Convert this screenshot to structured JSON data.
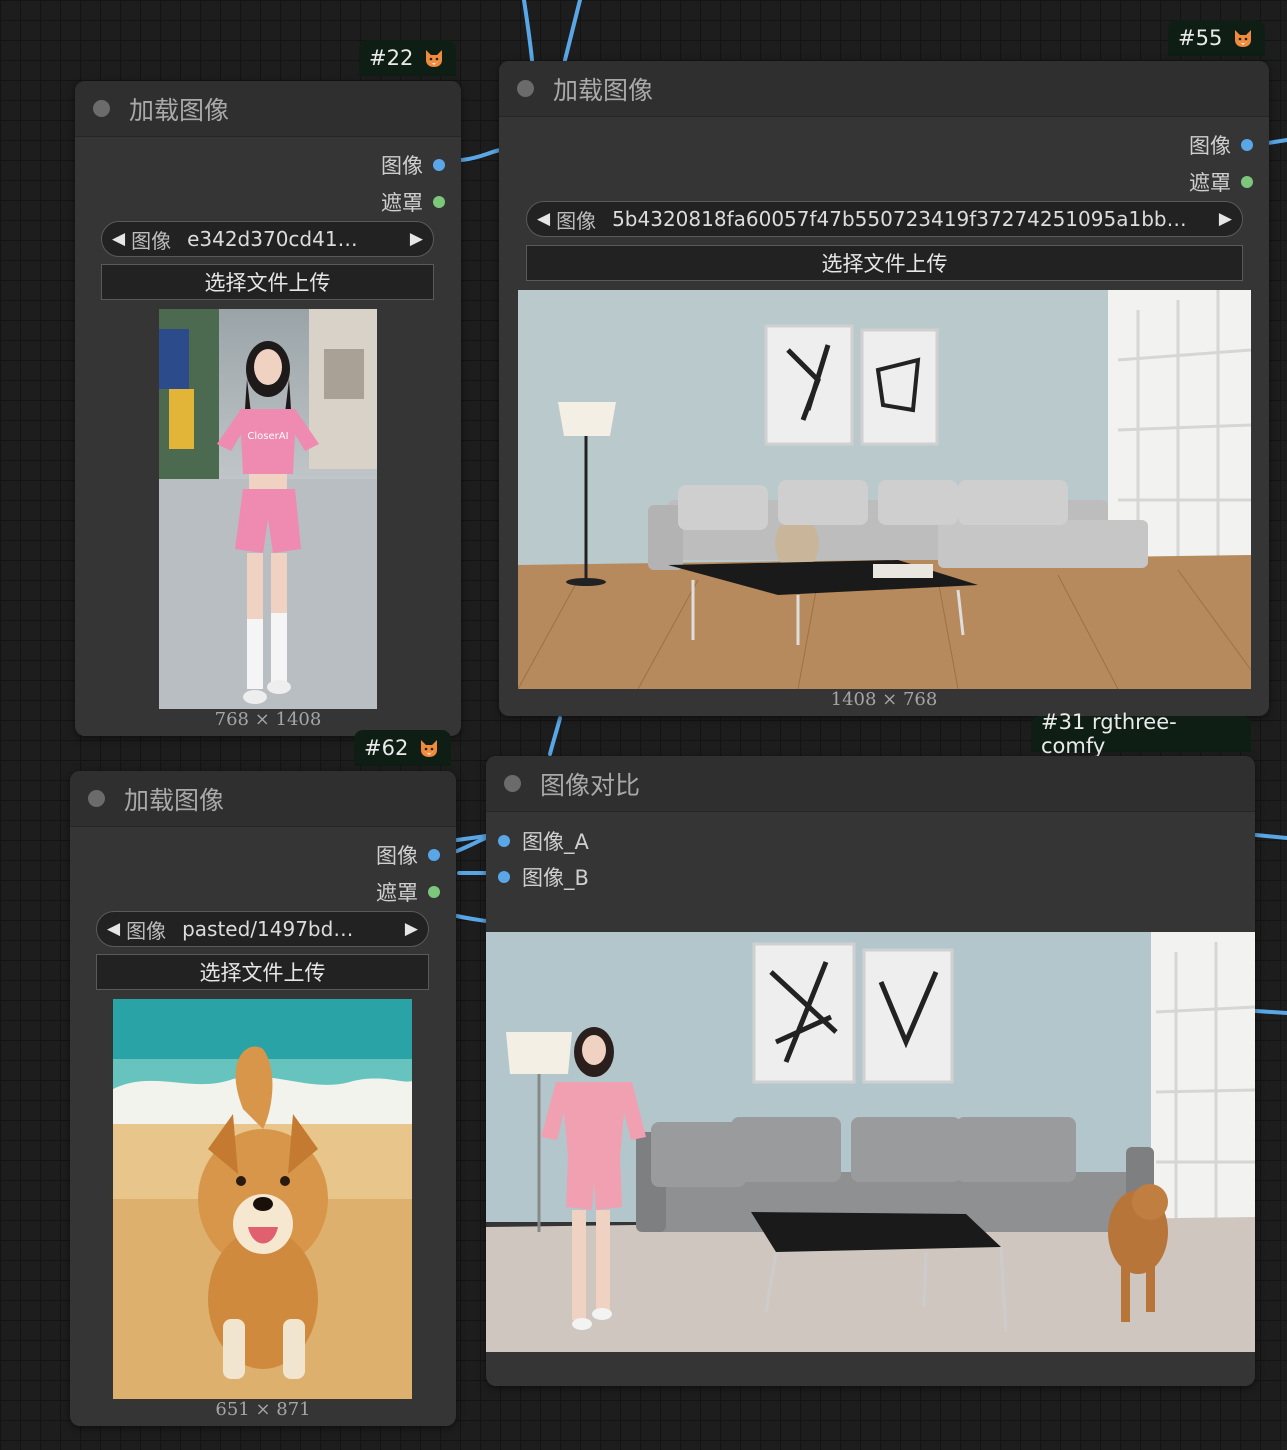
{
  "nodes": {
    "n22": {
      "badge": "#22",
      "title": "加载图像",
      "outputs": [
        "图像",
        "遮罩"
      ],
      "combo": {
        "label": "图像",
        "value": "e342d370cd41…"
      },
      "upload_label": "选择文件上传",
      "size": "768 × 1408"
    },
    "n55": {
      "badge": "#55",
      "title": "加载图像",
      "outputs": [
        "图像",
        "遮罩"
      ],
      "combo": {
        "label": "图像",
        "value": "5b4320818fa60057f47b550723419f37274251095a1bb…"
      },
      "upload_label": "选择文件上传",
      "size": "1408 × 768"
    },
    "n62": {
      "badge": "#62",
      "title": "加载图像",
      "outputs": [
        "图像",
        "遮罩"
      ],
      "combo": {
        "label": "图像",
        "value": "pasted/1497bd…"
      },
      "upload_label": "选择文件上传",
      "size": "651 × 871"
    },
    "n31": {
      "badge": "#31 rgthree-comfy",
      "title": "图像对比",
      "inputs": [
        "图像_A",
        "图像_B"
      ]
    }
  },
  "previews": {
    "n22": {
      "tshirt_text": "CloserAI"
    }
  },
  "colors": {
    "image_socket": "#5aa7e8",
    "mask_socket": "#7dc77d",
    "badge_bg": "#0f1e14",
    "node_bg": "#353535"
  },
  "icons": {
    "badge_icon": "fox-icon",
    "combo_prev": "triangle-left-icon",
    "combo_next": "triangle-right-icon"
  }
}
